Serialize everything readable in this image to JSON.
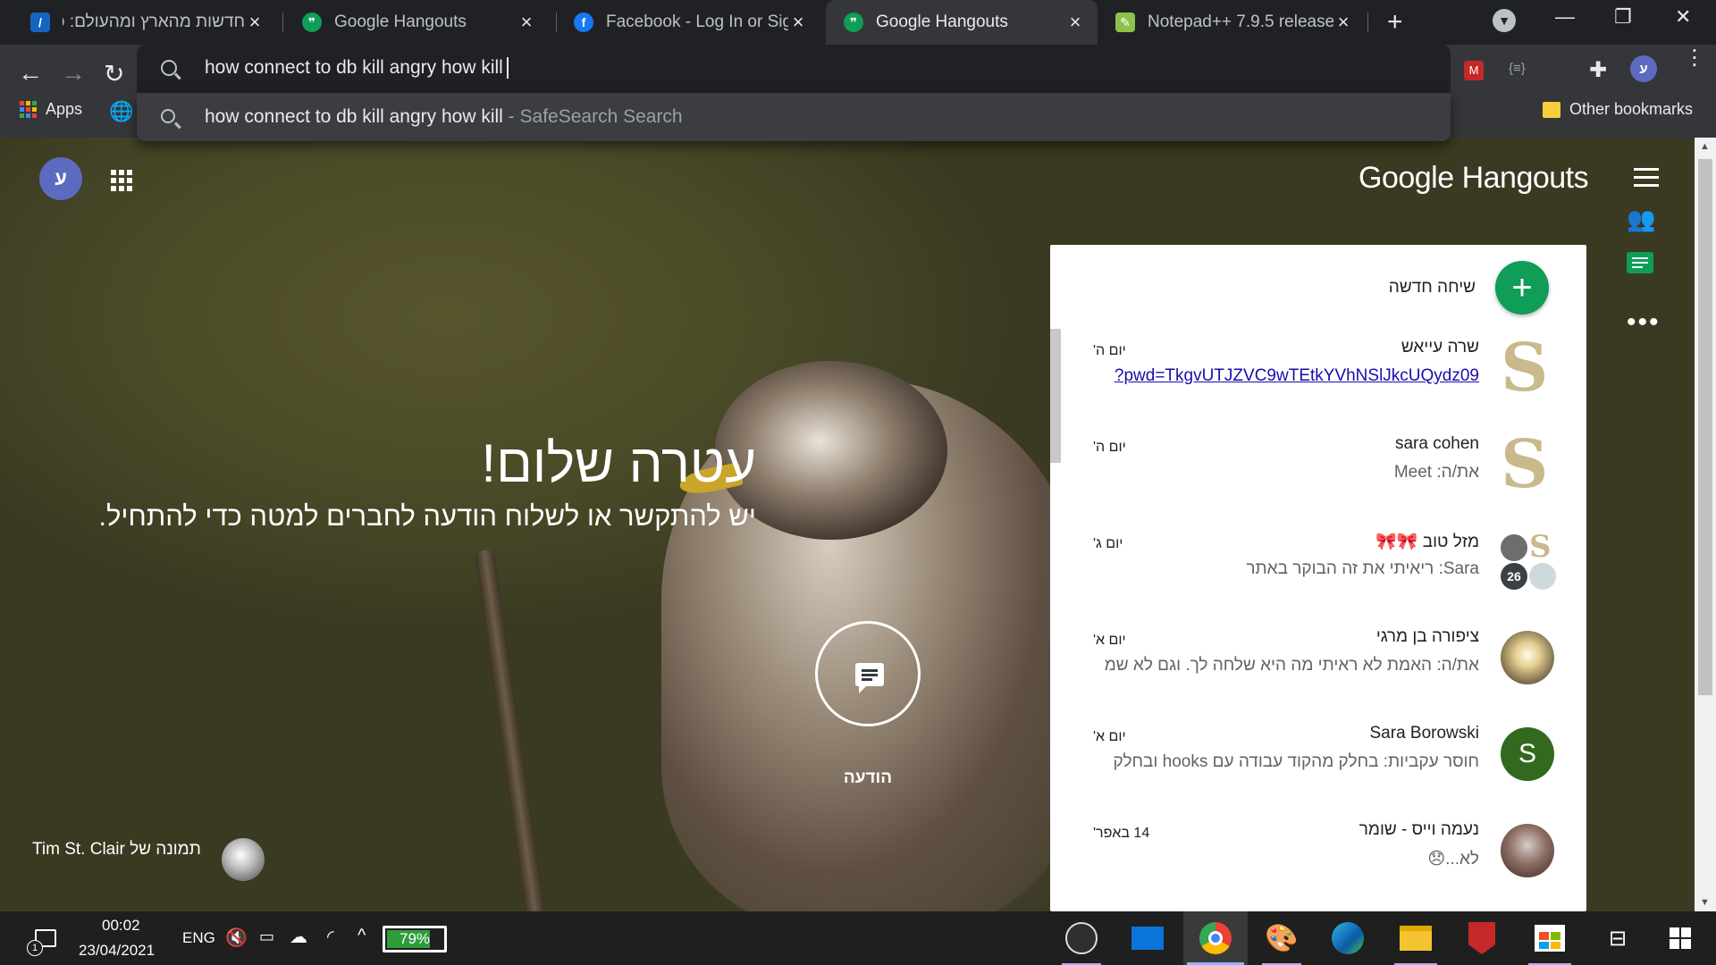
{
  "tabs": [
    {
      "title": "חדשות מהארץ ומהעולם: כ",
      "favicon": "ynet-icon",
      "active": false
    },
    {
      "title": "Google Hangouts",
      "favicon": "hangouts-icon",
      "active": false
    },
    {
      "title": "Facebook - Log In or Sign",
      "favicon": "facebook-icon",
      "active": false
    },
    {
      "title": "Google Hangouts",
      "favicon": "hangouts-icon",
      "active": true
    },
    {
      "title": "Notepad++ 7.9.5 release",
      "favicon": "notepad-icon",
      "active": false
    }
  ],
  "omnibox": {
    "query": "how connect to db kill angry how kill",
    "suggestion_text": "how connect to db kill angry how kill",
    "suggestion_sub": " - SafeSearch Search"
  },
  "bookmarks": {
    "apps_label": "Apps",
    "other_label": "Other bookmarks"
  },
  "profile_initial": "ע",
  "app": {
    "brand": "Google Hangouts",
    "greeting": "עטרה שלום!",
    "subtitle": "יש להתקשר או לשלוח הודעה לחברים למטה כדי להתחיל.",
    "message_label": "הודעה",
    "photo_credit": "תמונה של Tim St. Clair"
  },
  "panel": {
    "new_chat_label": "שיחה חדשה",
    "conversations": [
      {
        "name": "שרה עייאש",
        "snippet": "?pwd=TkgvUTJZVC9wTEtkYVhNSlJkcUQydz09",
        "date": "יום ה'",
        "avatar": "S",
        "is_link": true
      },
      {
        "name": "sara cohen",
        "snippet": "את/ה: Meet",
        "date": "יום ה'",
        "avatar": "S",
        "is_link": false
      },
      {
        "name": "מזל טוב 🎀🎀",
        "snippet": "Sara: ריאיתי את זה הבוקר באתר",
        "date": "יום ג'",
        "avatar": "group",
        "badge": "26",
        "is_link": false
      },
      {
        "name": "ציפורה בן מרגי",
        "snippet": "את/ה: האמת לא ראיתי מה היא שלחה לך. וגם לא שמ",
        "date": "יום א'",
        "avatar": "photo",
        "is_link": false
      },
      {
        "name": "Sara Borowski",
        "snippet": "חוסר עקביות:  בחלק מהקוד עבודה עם hooks ובחלק",
        "date": "יום א'",
        "avatar": "S",
        "is_link": false
      },
      {
        "name": "נעמה וייס - שומר",
        "snippet": "לא...😞",
        "date": "14 באפר'",
        "avatar": "photo",
        "is_link": false
      }
    ]
  },
  "taskbar": {
    "time": "00:02",
    "date": "23/04/2021",
    "language": "ENG",
    "battery": "79%",
    "battery_level": 0.79,
    "notification_count": "1"
  },
  "colors": {
    "accent_green": "#0f9d58",
    "link_blue": "#1a0dab",
    "profile_purple": "#5c6bc0",
    "chrome_dark": "#202124"
  }
}
